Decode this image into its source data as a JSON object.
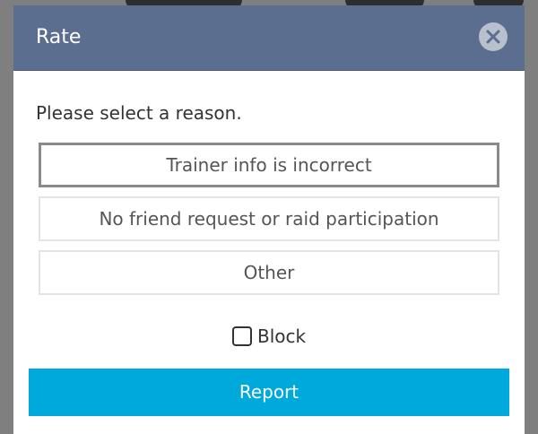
{
  "dialog": {
    "title": "Rate",
    "close_icon": "close-icon",
    "prompt": "Please select a reason.",
    "options": [
      {
        "label": "Trainer info is incorrect",
        "selected": true
      },
      {
        "label": "No friend request or raid participation",
        "selected": false
      },
      {
        "label": "Other",
        "selected": false
      }
    ],
    "block": {
      "label": "Block",
      "checked": false
    },
    "report_label": "Report"
  },
  "colors": {
    "header": "#5b6e8f",
    "accent": "#00a9dc",
    "backdrop": "#7f7f7f"
  }
}
